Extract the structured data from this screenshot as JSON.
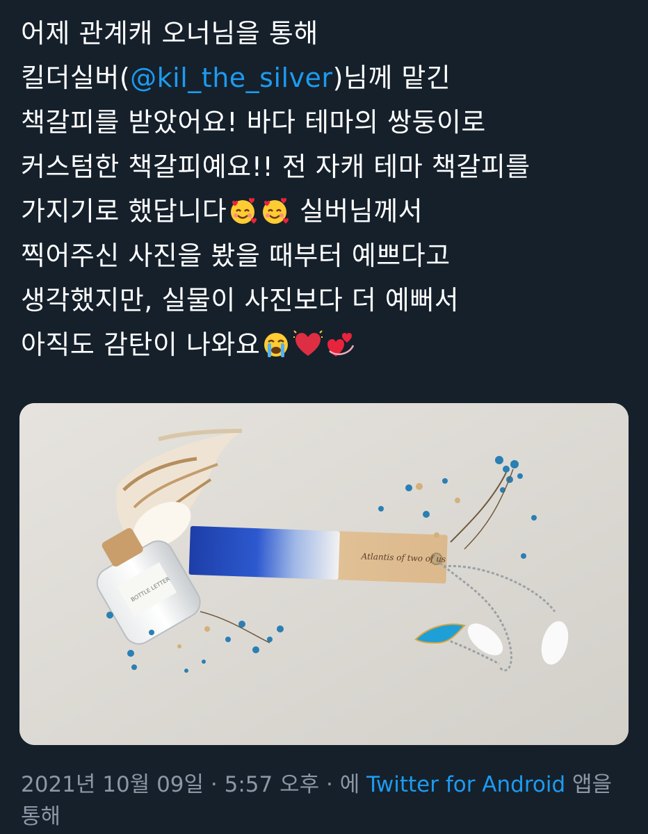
{
  "tweet": {
    "lines": {
      "l1": "어제 관계캐 오너님을 통해",
      "l2a": "킬더실버(",
      "l2_mention": "@kil_the_silver",
      "l2b": ")님께 맡긴",
      "l3": "책갈피를 받았어요! 바다 테마의 쌍둥이로",
      "l4": "커스텀한 책갈피예요!! 전 자캐 테마 책갈피를",
      "l5a": "가지기로 했답니다",
      "l5b": " 실버님께서",
      "l6": "찍어주신 사진을 봤을 때부터 예쁘다고",
      "l7": "생각했지만, 실물이 사진보다 더 예뻐서",
      "l8": "아직도 감탄이 나와요"
    },
    "emojis": [
      "smiling-face-with-hearts",
      "smiling-face-with-hearts",
      "loudly-crying-face",
      "beating-heart",
      "revolving-hearts"
    ],
    "image_text": {
      "bookmark_engraving": "Atlantis of two of us",
      "jar_label": "BOTTLE LETTER"
    },
    "colors": {
      "background": "#15202b",
      "link": "#1d9bf0",
      "meta_text": "#8b98a5"
    }
  },
  "meta": {
    "date": "2021년 10월 09일",
    "sep1": " · ",
    "time": "5:57 오후",
    "sep2": " · 에 ",
    "app": "Twitter for Android",
    "suffix": " 앱을 통해"
  }
}
